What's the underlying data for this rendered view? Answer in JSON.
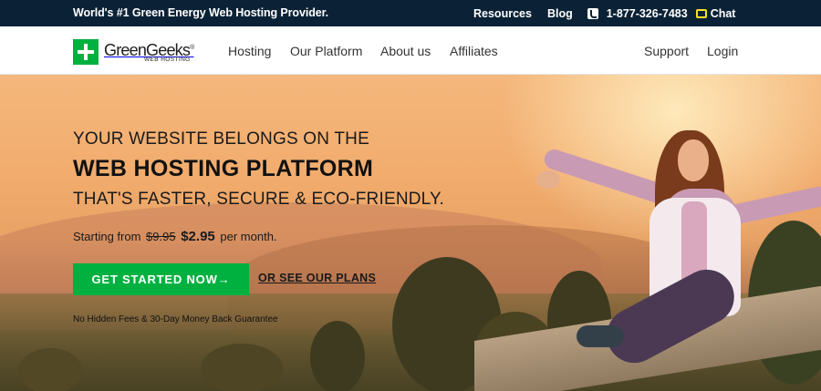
{
  "topbar": {
    "tagline": "World's #1 Green Energy Web Hosting Provider.",
    "resources": "Resources",
    "blog": "Blog",
    "phone": "1-877-326-7483",
    "chat": "Chat",
    "phone_icon": "phone-icon",
    "chat_icon": "chat-bubble-icon"
  },
  "nav": {
    "logo_name": "GreenGeeks",
    "logo_reg": "®",
    "logo_sub": "WEB HOSTING",
    "items": [
      "Hosting",
      "Our Platform",
      "About us",
      "Affiliates"
    ],
    "support": "Support",
    "login": "Login"
  },
  "hero": {
    "line1": "YOUR WEBSITE BELONGS ON THE",
    "line2": "WEB HOSTING PLATFORM",
    "line3": "THAT'S FASTER, SECURE & ECO-FRIENDLY.",
    "price_prefix": "Starting from",
    "price_old": "$9.95",
    "price_new": "$2.95",
    "price_suffix": "per month.",
    "cta": "GET STARTED NOW",
    "cta_arrow": "→",
    "plans_link": "OR SEE OUR PLANS",
    "guarantee": "No Hidden Fees & 30-Day Money Back Guarantee"
  },
  "colors": {
    "topbar_bg": "#0b2236",
    "brand_green": "#00b140",
    "chat_yellow": "#f5e31c"
  }
}
